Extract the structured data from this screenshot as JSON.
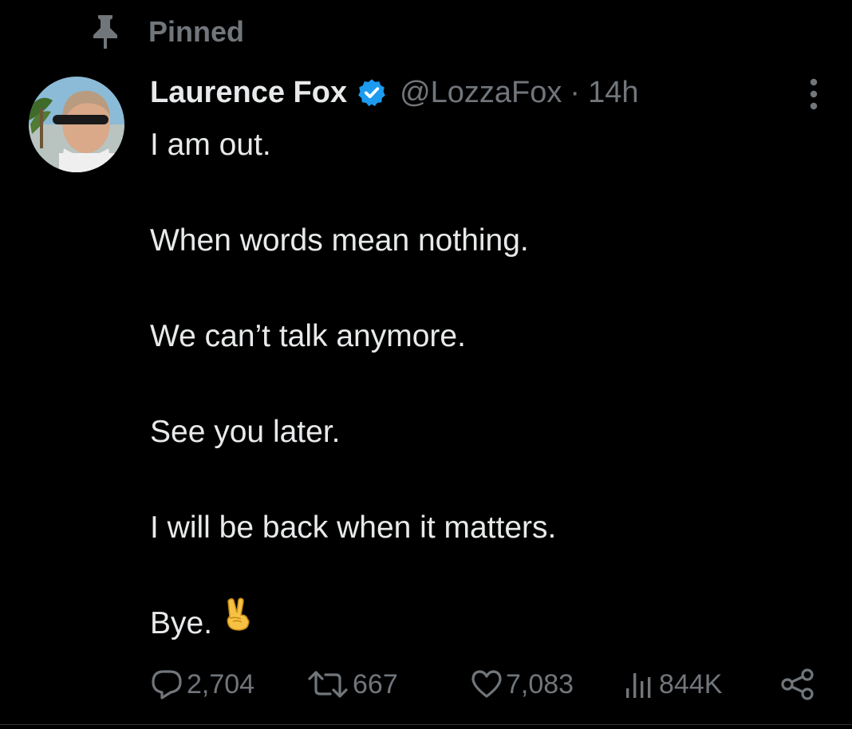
{
  "pinned": {
    "label": "Pinned",
    "icon": "pin-icon"
  },
  "author": {
    "display_name": "Laurence Fox",
    "handle": "@LozzaFox",
    "separator": "·",
    "timestamp": "14h",
    "verified": true,
    "verified_color": "#1d9bf0"
  },
  "tweet": {
    "lines": [
      "I am out.",
      "When words mean nothing.",
      "We can’t talk anymore.",
      "See you later.",
      "I will be back when it matters.",
      "Bye."
    ],
    "emoji": "victory-hand-emoji"
  },
  "actions": {
    "replies": "2,704",
    "reposts": "667",
    "likes": "7,083",
    "views": "844K"
  },
  "colors": {
    "background": "#000000",
    "primary_text": "#e7e9ea",
    "secondary_text": "#71767b",
    "accent": "#1d9bf0"
  }
}
